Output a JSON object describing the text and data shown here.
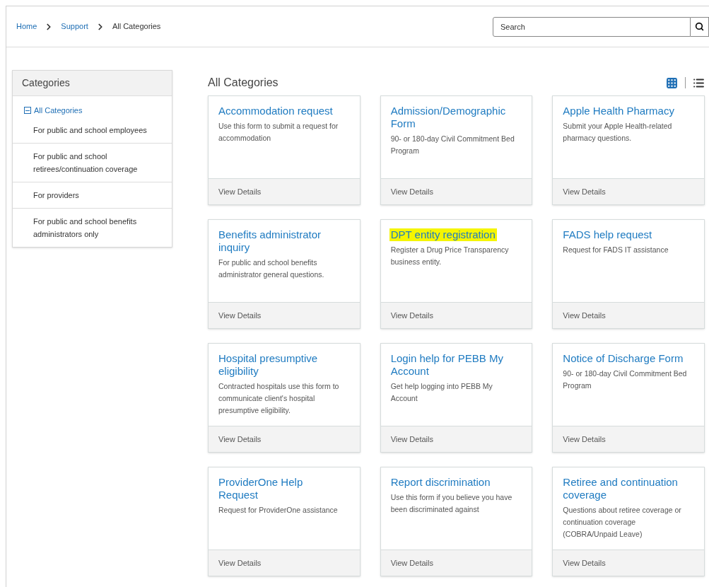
{
  "breadcrumb": [
    {
      "label": "Home",
      "link": true
    },
    {
      "label": "Support",
      "link": true
    },
    {
      "label": "All Categories",
      "link": false
    }
  ],
  "search": {
    "placeholder": "Search"
  },
  "sidebar": {
    "title": "Categories",
    "tree": {
      "label": "All Categories",
      "expanded": true,
      "children": [
        {
          "label": "For public and school employees"
        },
        {
          "label": "For public and school retirees/continuation coverage"
        },
        {
          "label": "For providers"
        },
        {
          "label": "For public and school benefits administrators only"
        }
      ]
    }
  },
  "main": {
    "title": "All Categories",
    "view_options": [
      {
        "kind": "grid",
        "selected": true
      },
      {
        "kind": "list",
        "selected": false
      }
    ],
    "cards": [
      {
        "title": "Accommodation request",
        "description": "Use this form to submit a request for accommodation",
        "action": "View Details",
        "highlighted": false
      },
      {
        "title": "Admission/Demographic Form",
        "description": "90- or 180-day Civil Commitment Bed Program",
        "action": "View Details",
        "highlighted": false
      },
      {
        "title": "Apple Health Pharmacy",
        "description": "Submit your Apple Health-related pharmacy questions.",
        "action": "View Details",
        "highlighted": false
      },
      {
        "title": "Benefits administrator inquiry",
        "description": "For public and school benefits administrator general questions.",
        "action": "View Details",
        "highlighted": false
      },
      {
        "title": "DPT entity registration",
        "description": "Register a Drug Price Transparency business entity.",
        "action": "View Details",
        "highlighted": true
      },
      {
        "title": "FADS help request",
        "description": "Request for FADS IT assistance",
        "action": "View Details",
        "highlighted": false
      },
      {
        "title": "Hospital presumptive eligibility",
        "description": "Contracted hospitals use this form to communicate client's hospital presumptive eligibility.",
        "action": "View Details",
        "highlighted": false
      },
      {
        "title": "Login help for PEBB My Account",
        "description": "Get help logging into PEBB My Account",
        "action": "View Details",
        "highlighted": false
      },
      {
        "title": "Notice of Discharge Form",
        "description": "90- or 180-day Civil Commitment Bed Program",
        "action": "View Details",
        "highlighted": false
      },
      {
        "title": "ProviderOne Help Request",
        "description": "Request for ProviderOne assistance",
        "action": "View Details",
        "highlighted": false
      },
      {
        "title": "Report discrimination",
        "description": "Use this form if you believe you have been discriminated against",
        "action": "View Details",
        "highlighted": false
      },
      {
        "title": "Retiree and continuation coverage",
        "description": "Questions about retiree coverage or continuation coverage (COBRA/Unpaid Leave)",
        "action": "View Details",
        "highlighted": false
      }
    ]
  }
}
